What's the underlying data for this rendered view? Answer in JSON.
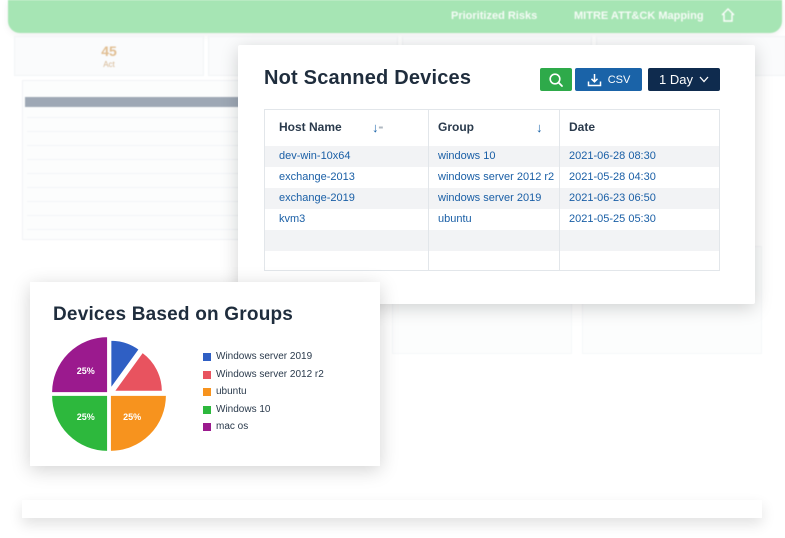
{
  "background": {
    "nav": [
      "Prioritized Risks",
      "MITRE ATT&CK Mapping"
    ],
    "stats": [
      {
        "value": "45",
        "label": "Act"
      }
    ]
  },
  "not_scanned": {
    "title": "Not Scanned Devices",
    "csv_label": "CSV",
    "range_label": "1 Day",
    "columns": [
      "Host Name",
      "Group",
      "Date"
    ],
    "rows": [
      {
        "host": "dev-win-10x64",
        "group": "windows 10",
        "date": "2021-06-28   08:30"
      },
      {
        "host": "exchange-2013",
        "group": "windows server 2012 r2",
        "date": "2021-05-28   04:30"
      },
      {
        "host": "exchange-2019",
        "group": "windows server 2019",
        "date": "2021-06-23   06:50"
      },
      {
        "host": "kvm3",
        "group": "ubuntu",
        "date": "2021-05-25  05:30"
      }
    ]
  },
  "groups_chart": {
    "title": "Devices Based on Groups",
    "legend": [
      {
        "label": "Windows server 2019",
        "color": "#2f5fc4"
      },
      {
        "label": "Windows server 2012 r2",
        "color": "#e8535f"
      },
      {
        "label": "ubuntu",
        "color": "#f7931e"
      },
      {
        "label": "Windows 10",
        "color": "#2db83d"
      },
      {
        "label": "mac os",
        "color": "#9b1a8e"
      }
    ]
  },
  "chart_data": {
    "type": "pie",
    "title": "Devices Based on Groups",
    "categories": [
      "Windows server 2019",
      "Windows server 2012 r2",
      "ubuntu",
      "Windows 10",
      "mac os"
    ],
    "values": [
      10,
      15,
      25,
      25,
      25
    ],
    "labels": [
      "",
      "",
      "25%",
      "25%",
      "25%"
    ],
    "colors": [
      "#2f5fc4",
      "#e8535f",
      "#f7931e",
      "#2db83d",
      "#9b1a8e"
    ],
    "legend": "right"
  }
}
